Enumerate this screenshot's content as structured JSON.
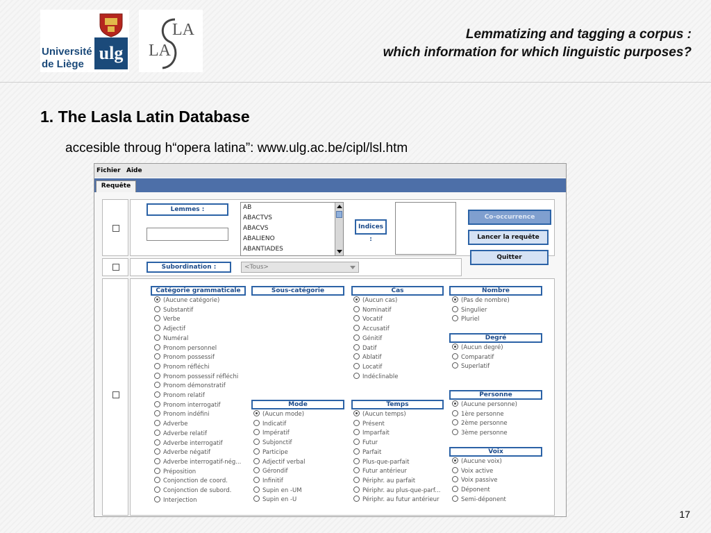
{
  "header": {
    "ulg_logo_line1": "Université",
    "ulg_logo_line2": "de Liège",
    "ulg_logo_mark": "ulg",
    "lasla_logo_text": "LASLA",
    "title_line1": "Lemmatizing and tagging a corpus :",
    "title_line2": "which information for which linguistic purposes?"
  },
  "section": {
    "title": "1. The Lasla Latin Database",
    "subtitle": "accesible throug h“opera latina”: www.ulg.ac.be/cipl/lsl.htm"
  },
  "app": {
    "menu": [
      "Fichier",
      "Aide"
    ],
    "tab": "Requête",
    "lemmes_label": "Lemmes :",
    "lemmes_input_value": "",
    "lemma_list": [
      "AB",
      "ABACTVS",
      "ABACVS",
      "ABALIENO",
      "ABANTIADES"
    ],
    "indices_label": "Indices :",
    "buttons": {
      "cooccurrence": "Co-occurrence",
      "launch": "Lancer la requête",
      "quit": "Quitter"
    },
    "subordination_label": "Subordination :",
    "subordination_value": "<Tous>",
    "groups": {
      "categorie": {
        "title": "Catégorie grammaticale",
        "options": [
          "(Aucune catégorie)",
          "Substantif",
          "Verbe",
          "Adjectif",
          "Numéral",
          "Pronom personnel",
          "Pronom possessif",
          "Pronom réfléchi",
          "Pronom possessif réfléchi",
          "Pronom démonstratif",
          "Pronom relatif",
          "Pronom interrogatif",
          "Pronom indéfini",
          "Adverbe",
          "Adverbe relatif",
          "Adverbe interrogatif",
          "Adverbe négatif",
          "Adverbe interrogatif-nég...",
          "Préposition",
          "Conjonction de coord.",
          "Conjonction de subord.",
          "Interjection"
        ]
      },
      "souscategorie": {
        "title": "Sous-catégorie",
        "options": []
      },
      "cas": {
        "title": "Cas",
        "options": [
          "(Aucun cas)",
          "Nominatif",
          "Vocatif",
          "Accusatif",
          "Génitif",
          "Datif",
          "Ablatif",
          "Locatif",
          "Indéclinable"
        ]
      },
      "nombre": {
        "title": "Nombre",
        "options": [
          "(Pas de nombre)",
          "Singulier",
          "Pluriel"
        ]
      },
      "degre": {
        "title": "Degré",
        "options": [
          "(Aucun degré)",
          "Comparatif",
          "Superlatif"
        ]
      },
      "personne": {
        "title": "Personne",
        "options": [
          "(Aucune personne)",
          "1ère personne",
          "2ème personne",
          "3ème personne"
        ]
      },
      "mode": {
        "title": "Mode",
        "options": [
          "(Aucun mode)",
          "Indicatif",
          "Impératif",
          "Subjonctif",
          "Participe",
          "Adjectif verbal",
          "Gérondif",
          "Infinitif",
          "Supin en -UM",
          "Supin en -U"
        ]
      },
      "temps": {
        "title": "Temps",
        "options": [
          "(Aucun temps)",
          "Présent",
          "Imparfait",
          "Futur",
          "Parfait",
          "Plus-que-parfait",
          "Futur antérieur",
          "Périphr. au parfait",
          "Périphr. au plus-que-parf...",
          "Périphr. au futur antérieur"
        ]
      },
      "voix": {
        "title": "Voix",
        "options": [
          "(Aucune voix)",
          "Voix active",
          "Voix passive",
          "Déponent",
          "Semi-déponent"
        ]
      }
    }
  },
  "page_number": "17",
  "colors": {
    "accent_blue": "#2b62a6",
    "tab_strip": "#4d6fa8"
  }
}
